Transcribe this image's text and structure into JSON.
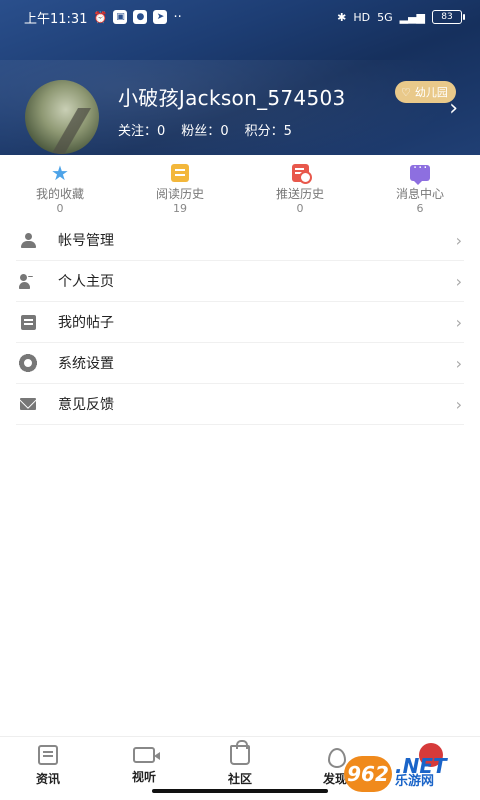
{
  "status_bar": {
    "time": "上午11:31",
    "battery": "83",
    "network": "5G",
    "hd": "HD"
  },
  "profile": {
    "username": "小破孩Jackson_574503",
    "level_badge": "幼儿园",
    "follow_label": "关注：",
    "follow_count": "0",
    "fans_label": "粉丝：",
    "fans_count": "0",
    "points_label": "积分：",
    "points_count": "5"
  },
  "quick_actions": [
    {
      "label": "我的收藏",
      "count": "0",
      "icon": "star-icon",
      "color": "#4da3e8"
    },
    {
      "label": "阅读历史",
      "count": "19",
      "icon": "document-icon",
      "color": "#f3b73b"
    },
    {
      "label": "推送历史",
      "count": "0",
      "icon": "push-history-icon",
      "color": "#e8584c"
    },
    {
      "label": "消息中心",
      "count": "6",
      "icon": "message-icon",
      "color": "#8d6fe0"
    }
  ],
  "menu": [
    {
      "label": "帐号管理",
      "icon": "person-icon"
    },
    {
      "label": "个人主页",
      "icon": "profile-home-icon"
    },
    {
      "label": "我的帖子",
      "icon": "post-icon"
    },
    {
      "label": "系统设置",
      "icon": "gear-icon"
    },
    {
      "label": "意见反馈",
      "icon": "mail-icon"
    }
  ],
  "chevron": "›",
  "bottom_nav": [
    {
      "label": "资讯",
      "icon": "news-icon"
    },
    {
      "label": "视听",
      "icon": "video-icon"
    },
    {
      "label": "社区",
      "icon": "community-icon"
    },
    {
      "label": "发现",
      "icon": "discover-icon"
    },
    {
      "label": "",
      "icon": "me-icon"
    }
  ],
  "watermark": {
    "logo": "962",
    "net": ".NET",
    "cn": "乐游网"
  }
}
